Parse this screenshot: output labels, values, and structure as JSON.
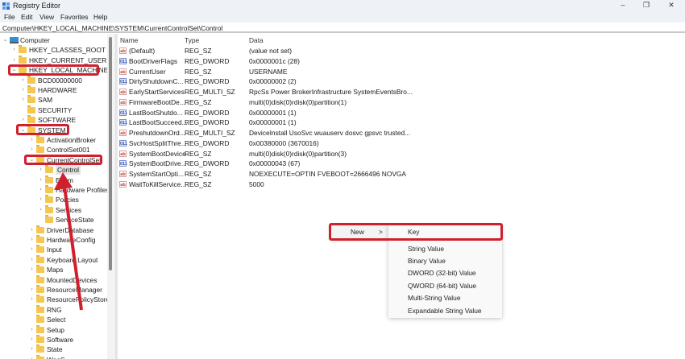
{
  "window": {
    "title": "Registry Editor",
    "minimize": "–",
    "maximize": "❐",
    "close": "✕"
  },
  "menu": [
    "File",
    "Edit",
    "View",
    "Favorites",
    "Help"
  ],
  "address": "Computer\\HKEY_LOCAL_MACHINE\\SYSTEM\\CurrentControlSet\\Control",
  "tree": [
    {
      "label": "Computer",
      "level": 0,
      "chev": "v",
      "icon": "computer"
    },
    {
      "label": "HKEY_CLASSES_ROOT",
      "level": 1,
      "chev": ">"
    },
    {
      "label": "HKEY_CURRENT_USER",
      "level": 1,
      "chev": ">"
    },
    {
      "label": "HKEY_LOCAL_MACHINE",
      "level": 1,
      "chev": "v"
    },
    {
      "label": "BCD00000000",
      "level": 2,
      "chev": ">"
    },
    {
      "label": "HARDWARE",
      "level": 2,
      "chev": ">"
    },
    {
      "label": "SAM",
      "level": 2,
      "chev": ">"
    },
    {
      "label": "SECURITY",
      "level": 2,
      "chev": ""
    },
    {
      "label": "SOFTWARE",
      "level": 2,
      "chev": ">"
    },
    {
      "label": "SYSTEM",
      "level": 2,
      "chev": "v"
    },
    {
      "label": "ActivationBroker",
      "level": 3,
      "chev": ">"
    },
    {
      "label": "ControlSet001",
      "level": 3,
      "chev": ">"
    },
    {
      "label": "CurrentControlSet",
      "level": 3,
      "chev": "v"
    },
    {
      "label": "Control",
      "level": 4,
      "chev": ">",
      "selected": true
    },
    {
      "label": "Enum",
      "level": 4,
      "chev": ">"
    },
    {
      "label": "Hardware Profiles",
      "level": 4,
      "chev": ">"
    },
    {
      "label": "Policies",
      "level": 4,
      "chev": ">"
    },
    {
      "label": "Services",
      "level": 4,
      "chev": ">"
    },
    {
      "label": "ServiceState",
      "level": 4,
      "chev": ""
    },
    {
      "label": "DriverDatabase",
      "level": 3,
      "chev": ">"
    },
    {
      "label": "HardwareConfig",
      "level": 3,
      "chev": ">"
    },
    {
      "label": "Input",
      "level": 3,
      "chev": ">"
    },
    {
      "label": "Keyboard Layout",
      "level": 3,
      "chev": ">"
    },
    {
      "label": "Maps",
      "level": 3,
      "chev": ">"
    },
    {
      "label": "MountedDevices",
      "level": 3,
      "chev": ""
    },
    {
      "label": "ResourceManager",
      "level": 3,
      "chev": ">"
    },
    {
      "label": "ResourcePolicyStore",
      "level": 3,
      "chev": ">"
    },
    {
      "label": "RNG",
      "level": 3,
      "chev": ""
    },
    {
      "label": "Select",
      "level": 3,
      "chev": ""
    },
    {
      "label": "Setup",
      "level": 3,
      "chev": ">"
    },
    {
      "label": "Software",
      "level": 3,
      "chev": ">"
    },
    {
      "label": "State",
      "level": 3,
      "chev": ">"
    },
    {
      "label": "WaaS",
      "level": 3,
      "chev": ">"
    }
  ],
  "list": {
    "headers": {
      "name": "Name",
      "type": "Type",
      "data": "Data"
    },
    "rows": [
      {
        "name": "(Default)",
        "type": "REG_SZ",
        "data": "(value not set)",
        "icon": "sz"
      },
      {
        "name": "BootDriverFlags",
        "type": "REG_DWORD",
        "data": "0x0000001c (28)",
        "icon": "dw"
      },
      {
        "name": "CurrentUser",
        "type": "REG_SZ",
        "data": "USERNAME",
        "icon": "sz"
      },
      {
        "name": "DirtyShutdownC...",
        "type": "REG_DWORD",
        "data": "0x00000002 (2)",
        "icon": "dw"
      },
      {
        "name": "EarlyStartServices",
        "type": "REG_MULTI_SZ",
        "data": "RpcSs Power BrokerInfrastructure SystemEventsBro...",
        "icon": "sz"
      },
      {
        "name": "FirmwareBootDe...",
        "type": "REG_SZ",
        "data": "multi(0)disk(0)rdisk(0)partition(1)",
        "icon": "sz"
      },
      {
        "name": "LastBootShutdo...",
        "type": "REG_DWORD",
        "data": "0x00000001 (1)",
        "icon": "dw"
      },
      {
        "name": "LastBootSucceed...",
        "type": "REG_DWORD",
        "data": "0x00000001 (1)",
        "icon": "dw"
      },
      {
        "name": "PreshutdownOrd...",
        "type": "REG_MULTI_SZ",
        "data": "DeviceInstall UsoSvc wuauserv dosvc gpsvc trusted...",
        "icon": "sz"
      },
      {
        "name": "SvcHostSplitThre...",
        "type": "REG_DWORD",
        "data": "0x00380000 (3670016)",
        "icon": "dw"
      },
      {
        "name": "SystemBootDevice",
        "type": "REG_SZ",
        "data": "multi(0)disk(0)rdisk(0)partition(3)",
        "icon": "sz"
      },
      {
        "name": "SystemBootDrive...",
        "type": "REG_DWORD",
        "data": "0x00000043 (67)",
        "icon": "dw"
      },
      {
        "name": "SystemStartOpti...",
        "type": "REG_SZ",
        "data": " NOEXECUTE=OPTIN  FVEBOOT=2666496  NOVGA",
        "icon": "sz"
      },
      {
        "name": "WaitToKillService...",
        "type": "REG_SZ",
        "data": "5000",
        "icon": "sz"
      }
    ]
  },
  "context_menu": {
    "new_label": "New",
    "arrow": ">",
    "submenu": [
      "Key",
      "String Value",
      "Binary Value",
      "DWORD (32-bit) Value",
      "QWORD (64-bit) Value",
      "Multi-String Value",
      "Expandable String Value"
    ]
  },
  "colors": {
    "highlight": "#d0202d",
    "folder": "#f5c650"
  }
}
